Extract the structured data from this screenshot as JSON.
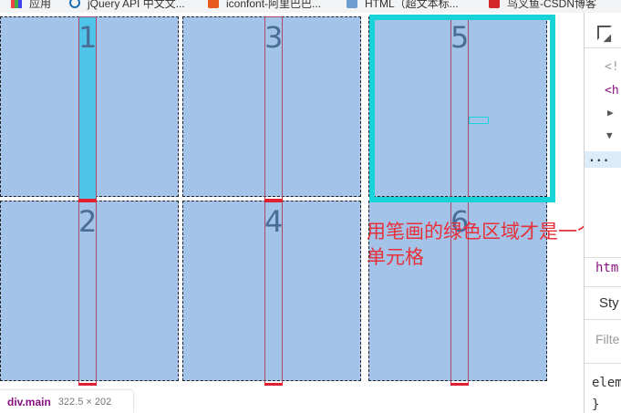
{
  "bookmarks": [
    {
      "label": "应用",
      "icon": "apps-grid-icon"
    },
    {
      "label": "jQuery API 中文文...",
      "icon": "jquery-icon"
    },
    {
      "label": "iconfont-阿里巴巴...",
      "icon": "iconfont-icon"
    },
    {
      "label": "HTML（超文本标...",
      "icon": "bookmark-icon"
    },
    {
      "label": "鸟叉鱼-CSDN博客",
      "icon": "csdn-icon"
    }
  ],
  "grid": {
    "cells": [
      "1",
      "3",
      "5",
      "2",
      "4",
      "6"
    ]
  },
  "annotation": {
    "text": "用笔画的绿色区域才是一个单元格",
    "color": "#e8303a"
  },
  "tooltip": {
    "element": "div.main",
    "size": "322.5 × 202"
  },
  "devtools": {
    "lines": [
      "<!",
      "<h",
      "▶",
      "▼",
      "...",
      "htm",
      "Sty",
      "Filte",
      "elem",
      "}"
    ]
  },
  "colors": {
    "cell": "#a3c4e8",
    "highlight": "#18d4d8",
    "column": "#b0476a"
  }
}
